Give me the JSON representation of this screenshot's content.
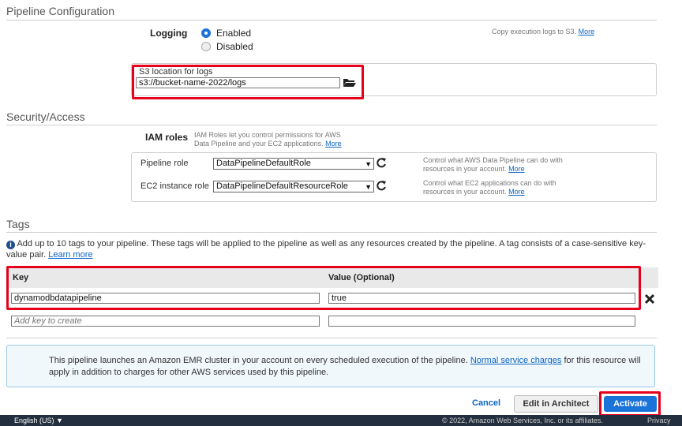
{
  "pipeline": {
    "title": "Pipeline Configuration",
    "logging_label": "Logging",
    "radio_enabled": "Enabled",
    "radio_disabled": "Disabled",
    "copy_text": "Copy execution logs to S3.",
    "more_link": "More",
    "s3_label": "S3 location for logs",
    "s3_value": "s3://bucket-name-2022/logs",
    "folder_icon": "folder-icon"
  },
  "security": {
    "title": "Security/Access",
    "iam_label": "IAM roles",
    "iam_desc_line1": "IAM Roles let you control permissions for AWS",
    "iam_desc_line2": "Data Pipeline and your EC2 applications.",
    "iam_more": "More",
    "pipeline_role_label": "Pipeline role",
    "pipeline_role_value": "DataPipelineDefaultRole",
    "pipeline_role_desc_line1": "Control what AWS Data Pipeline can do with",
    "pipeline_role_desc_line2": "resources in your account.",
    "pipeline_role_more": "More",
    "ec2_role_label": "EC2 instance role",
    "ec2_role_value": "DataPipelineDefaultResourceRole",
    "ec2_role_desc_line1": "Control what EC2 applications can do with",
    "ec2_role_desc_line2": "resources in your account.",
    "ec2_role_more": "More",
    "refresh_icon": "refresh-icon"
  },
  "tags": {
    "title": "Tags",
    "info_text": "Add up to 10 tags to your pipeline. These tags will be applied to the pipeline as well as any resources created by the pipeline. A tag consists of a case-sensitive key-value pair.",
    "learn_more": "Learn more",
    "col_key": "Key",
    "col_value": "Value (Optional)",
    "rows": [
      {
        "key": "dynamodbdatapipeline",
        "value": "true"
      }
    ],
    "new_key_placeholder": "Add key to create",
    "remove_icon": "close-icon"
  },
  "notice": {
    "text_before": "This pipeline launches an Amazon EMR cluster in your account on every scheduled execution of the pipeline.",
    "link": "Normal service charges",
    "text_after": "for this resource will apply in addition to charges for other AWS services used by this pipeline."
  },
  "actions": {
    "cancel": "Cancel",
    "edit": "Edit in Architect",
    "activate": "Activate"
  },
  "footer": {
    "language": "English (US) ▼",
    "copyright": "© 2022, Amazon Web Services, Inc. or its affiliates.",
    "privacy": "Privacy"
  },
  "colors": {
    "accent": "#1a73d9",
    "highlight": "#e5001c",
    "footer_bg": "#232f3e"
  }
}
